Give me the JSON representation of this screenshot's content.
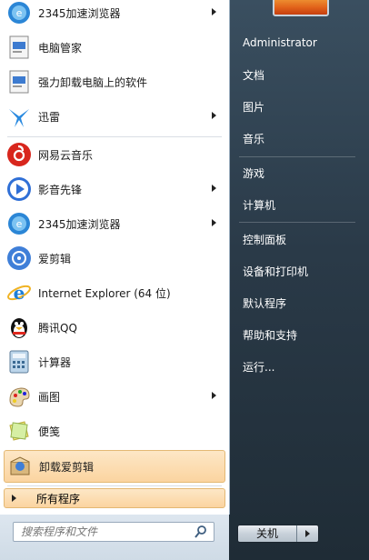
{
  "left_menu": {
    "pinned": [
      {
        "label": "2345加速浏览器",
        "has_submenu": true,
        "icon": "browser-2345-icon"
      },
      {
        "label": "电脑管家",
        "has_submenu": false,
        "icon": "pc-manager-icon"
      },
      {
        "label": "强力卸载电脑上的软件",
        "has_submenu": false,
        "icon": "uninstaller-icon"
      },
      {
        "label": "迅雷",
        "has_submenu": true,
        "icon": "xunlei-icon"
      }
    ],
    "recent": [
      {
        "label": "网易云音乐",
        "has_submenu": false,
        "icon": "netease-music-icon"
      },
      {
        "label": "影音先锋",
        "has_submenu": true,
        "icon": "media-player-icon"
      },
      {
        "label": "2345加速浏览器",
        "has_submenu": true,
        "icon": "browser-2345-icon"
      },
      {
        "label": "爱剪辑",
        "has_submenu": false,
        "icon": "video-editor-icon"
      },
      {
        "label": "Internet Explorer (64 位)",
        "has_submenu": false,
        "icon": "internet-explorer-icon"
      },
      {
        "label": "腾讯QQ",
        "has_submenu": false,
        "icon": "qq-penguin-icon"
      },
      {
        "label": "计算器",
        "has_submenu": false,
        "icon": "calculator-icon"
      },
      {
        "label": "画图",
        "has_submenu": true,
        "icon": "paint-palette-icon"
      },
      {
        "label": "便笺",
        "has_submenu": false,
        "icon": "sticky-notes-icon"
      },
      {
        "label": "卸载爱剪辑",
        "has_submenu": false,
        "icon": "uninstall-editor-icon"
      }
    ],
    "all_programs_label": "所有程序"
  },
  "search": {
    "placeholder": "搜索程序和文件"
  },
  "right_menu": {
    "user": "Administrator",
    "items": [
      "文档",
      "图片",
      "音乐",
      "游戏",
      "计算机",
      "控制面板",
      "设备和打印机",
      "默认程序",
      "帮助和支持",
      "运行..."
    ]
  },
  "shutdown": {
    "label": "关机"
  }
}
